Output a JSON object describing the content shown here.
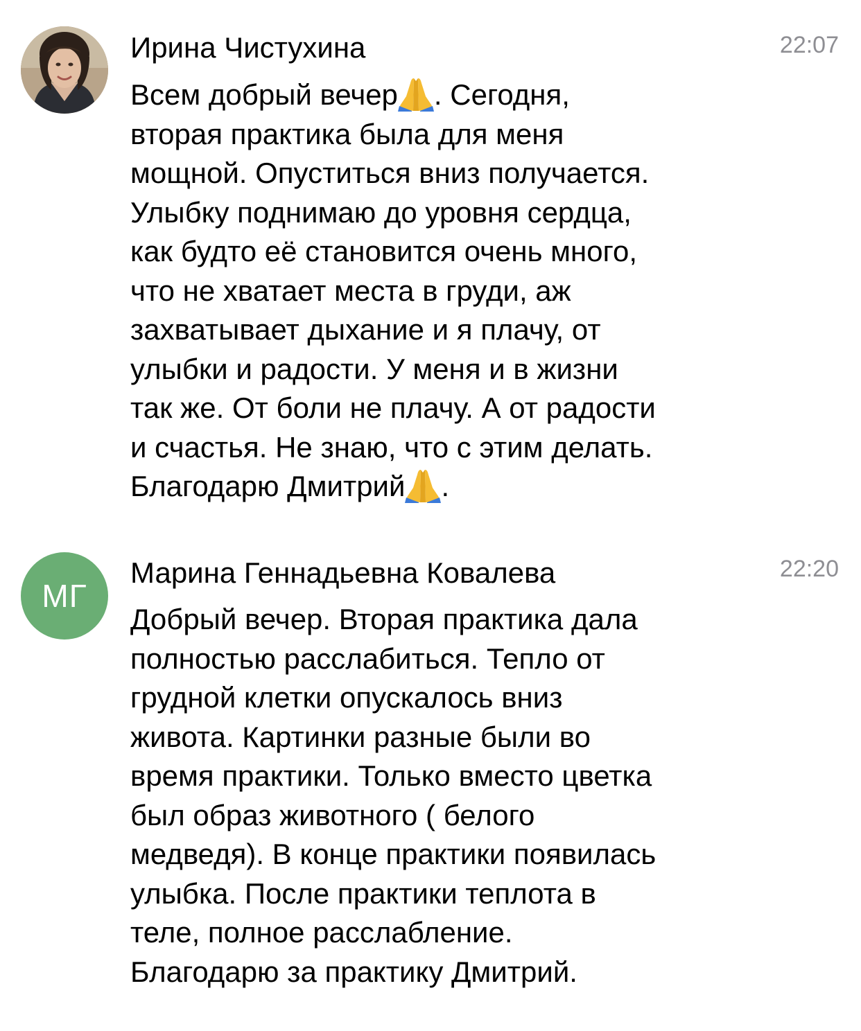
{
  "comments": [
    {
      "author": "Ирина Чистухина",
      "time": "22:07",
      "avatar_icon": "user-photo",
      "lines": [
        {
          "before": "Всем добрый вечер",
          "emoji": "🙏",
          "after": ". Сегодня,"
        },
        {
          "text": "вторая практика была для меня"
        },
        {
          "text": "мощной. Опуститься вниз получается."
        },
        {
          "text": "Улыбку поднимаю до уровня сердца,"
        },
        {
          "text": "как будто её становится очень много,"
        },
        {
          "text": "что не хватает места в груди, аж"
        },
        {
          "text": "захватывает дыхание и я плачу, от"
        },
        {
          "text": "улыбки и радости. У меня и в жизни"
        },
        {
          "text": "так же. От боли не плачу. А от радости"
        },
        {
          "text": "и счастья. Не знаю, что с этим делать."
        },
        {
          "before": "Благодарю Дмитрий",
          "emoji": "🙏",
          "after": "."
        }
      ]
    },
    {
      "author": "Марина Геннадьевна Ковалева",
      "time": "22:20",
      "avatar_initials": "МГ",
      "avatar_color": "#6aae74",
      "lines": [
        {
          "text": "Добрый вечер. Вторая практика дала"
        },
        {
          "text": "полностью расслабиться. Тепло от"
        },
        {
          "text": "грудной клетки опускалось вниз"
        },
        {
          "text": "живота. Картинки разные были во"
        },
        {
          "text": "время практики. Только вместо цветка"
        },
        {
          "text": "был образ животного ( белого"
        },
        {
          "text": "медведя). В конце практики появилась"
        },
        {
          "text": "улыбка. После практики теплота в"
        },
        {
          "text": "теле, полное расслабление."
        },
        {
          "text": "Благодарю за практику Дмитрий."
        }
      ]
    }
  ]
}
